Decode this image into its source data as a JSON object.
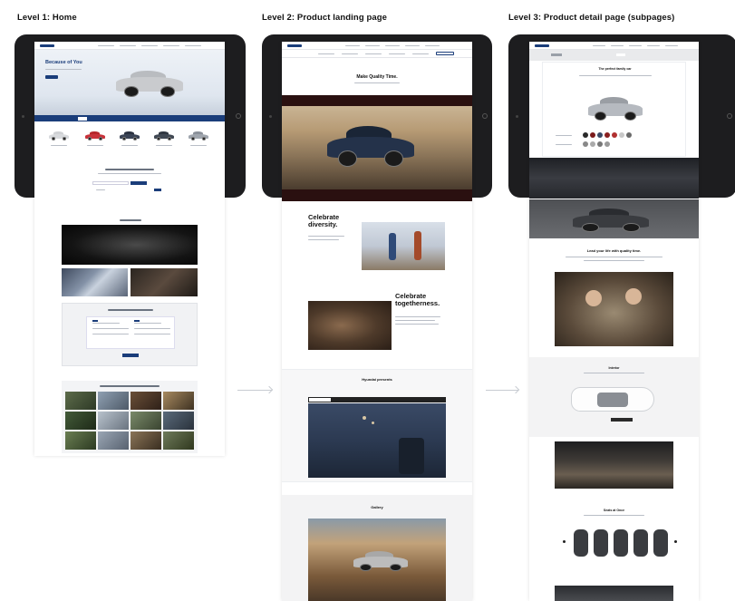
{
  "levels": [
    {
      "title": "Level 1: Home"
    },
    {
      "title": "Level 2: Product landing page"
    },
    {
      "title": "Level 3: Product detail page (subpages)"
    }
  ],
  "home": {
    "hero_title": "Because of You",
    "nav_logo": "HYUNDAI"
  },
  "landing": {
    "hero_title": "Make Quality Time.",
    "section1_heading": "Celebrate diversity.",
    "section2_heading": "Celebrate togetherness.",
    "section3_heading": "Hyundai presents",
    "section4_heading": "Gallery"
  },
  "detail": {
    "hero_title": "The perfect family car",
    "section1_heading": "Lead your life with quality time.",
    "section2_heading": "Interior",
    "section3_heading": "Seats at Once"
  },
  "colors": {
    "hyundai_blue": "#1a3d7a",
    "ipad_frame": "#1d1d1f",
    "arrow": "#c8ccd2"
  }
}
